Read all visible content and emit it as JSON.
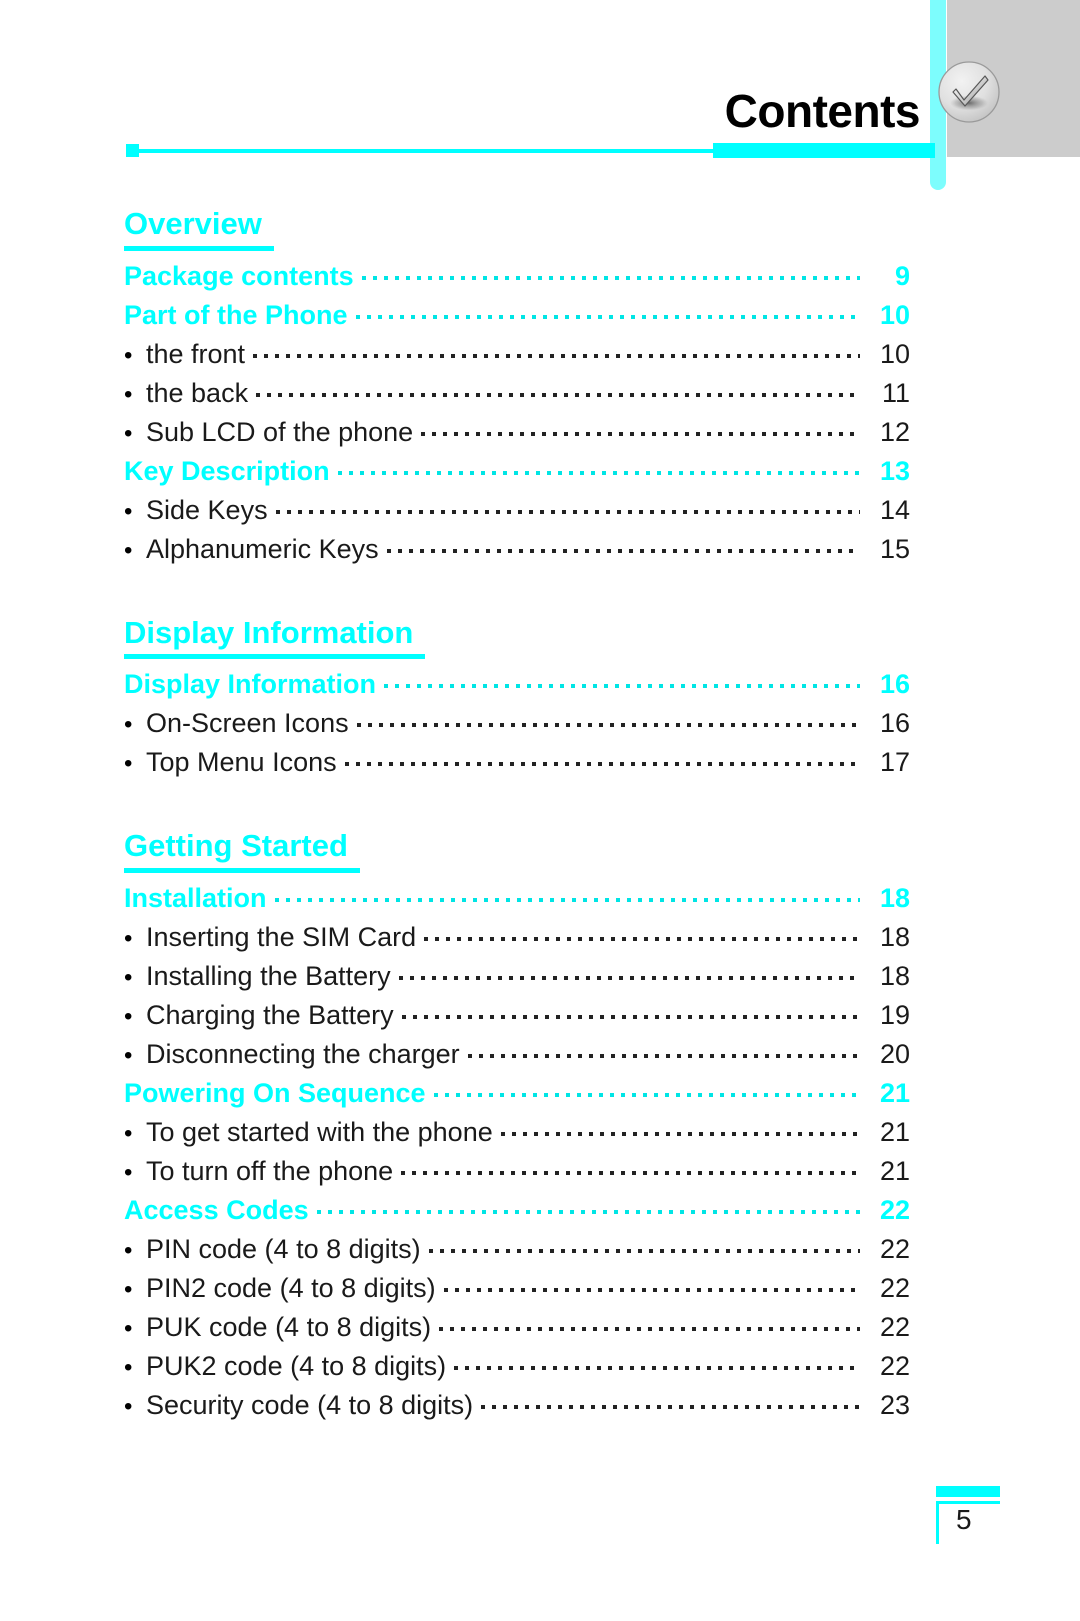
{
  "header": {
    "title": "Contents",
    "tab_icon": "checkmark-badge-icon"
  },
  "footer": {
    "page_number": "5"
  },
  "sections": [
    {
      "heading": "Overview",
      "entries": [
        {
          "type": "major",
          "label": "Package contents",
          "page": "9"
        },
        {
          "type": "major",
          "label": "Part of the Phone",
          "page": "10"
        },
        {
          "type": "minor",
          "label": "the front",
          "page": "10"
        },
        {
          "type": "minor",
          "label": "the back",
          "page": "11"
        },
        {
          "type": "minor",
          "label": "Sub LCD of the phone",
          "page": "12"
        },
        {
          "type": "major",
          "label": "Key Description",
          "page": "13"
        },
        {
          "type": "minor",
          "label": "Side Keys",
          "page": "14"
        },
        {
          "type": "minor",
          "label": "Alphanumeric Keys",
          "page": "15"
        }
      ]
    },
    {
      "heading": "Display Information",
      "entries": [
        {
          "type": "major",
          "label": "Display Information",
          "page": "16"
        },
        {
          "type": "minor",
          "label": "On-Screen Icons",
          "page": "16"
        },
        {
          "type": "minor",
          "label": "Top Menu Icons",
          "page": "17"
        }
      ]
    },
    {
      "heading": "Getting Started",
      "entries": [
        {
          "type": "major",
          "label": "Installation",
          "page": "18"
        },
        {
          "type": "minor",
          "label": "Inserting the SIM Card",
          "page": "18"
        },
        {
          "type": "minor",
          "label": "Installing the Battery",
          "page": "18"
        },
        {
          "type": "minor",
          "label": "Charging the Battery",
          "page": "19"
        },
        {
          "type": "minor",
          "label": "Disconnecting the charger",
          "page": "20"
        },
        {
          "type": "major",
          "label": "Powering On Sequence",
          "page": "21"
        },
        {
          "type": "minor",
          "label": "To get started with the phone",
          "page": "21"
        },
        {
          "type": "minor",
          "label": "To turn off the phone",
          "page": "21"
        },
        {
          "type": "major",
          "label": "Access Codes",
          "page": "22"
        },
        {
          "type": "minor",
          "label": "PIN code (4 to 8 digits)",
          "page": "22"
        },
        {
          "type": "minor",
          "label": "PIN2 code (4 to 8 digits)",
          "page": "22"
        },
        {
          "type": "minor",
          "label": "PUK code (4 to 8 digits)",
          "page": "22"
        },
        {
          "type": "minor",
          "label": "PUK2 code (4 to 8 digits)",
          "page": "22"
        },
        {
          "type": "minor",
          "label": "Security code (4 to 8 digits)",
          "page": "23"
        }
      ]
    }
  ],
  "colors": {
    "accent": "#00ffff",
    "tab_background": "#cccccc",
    "text": "#1a1a1a"
  },
  "bullet_glyph": "•"
}
